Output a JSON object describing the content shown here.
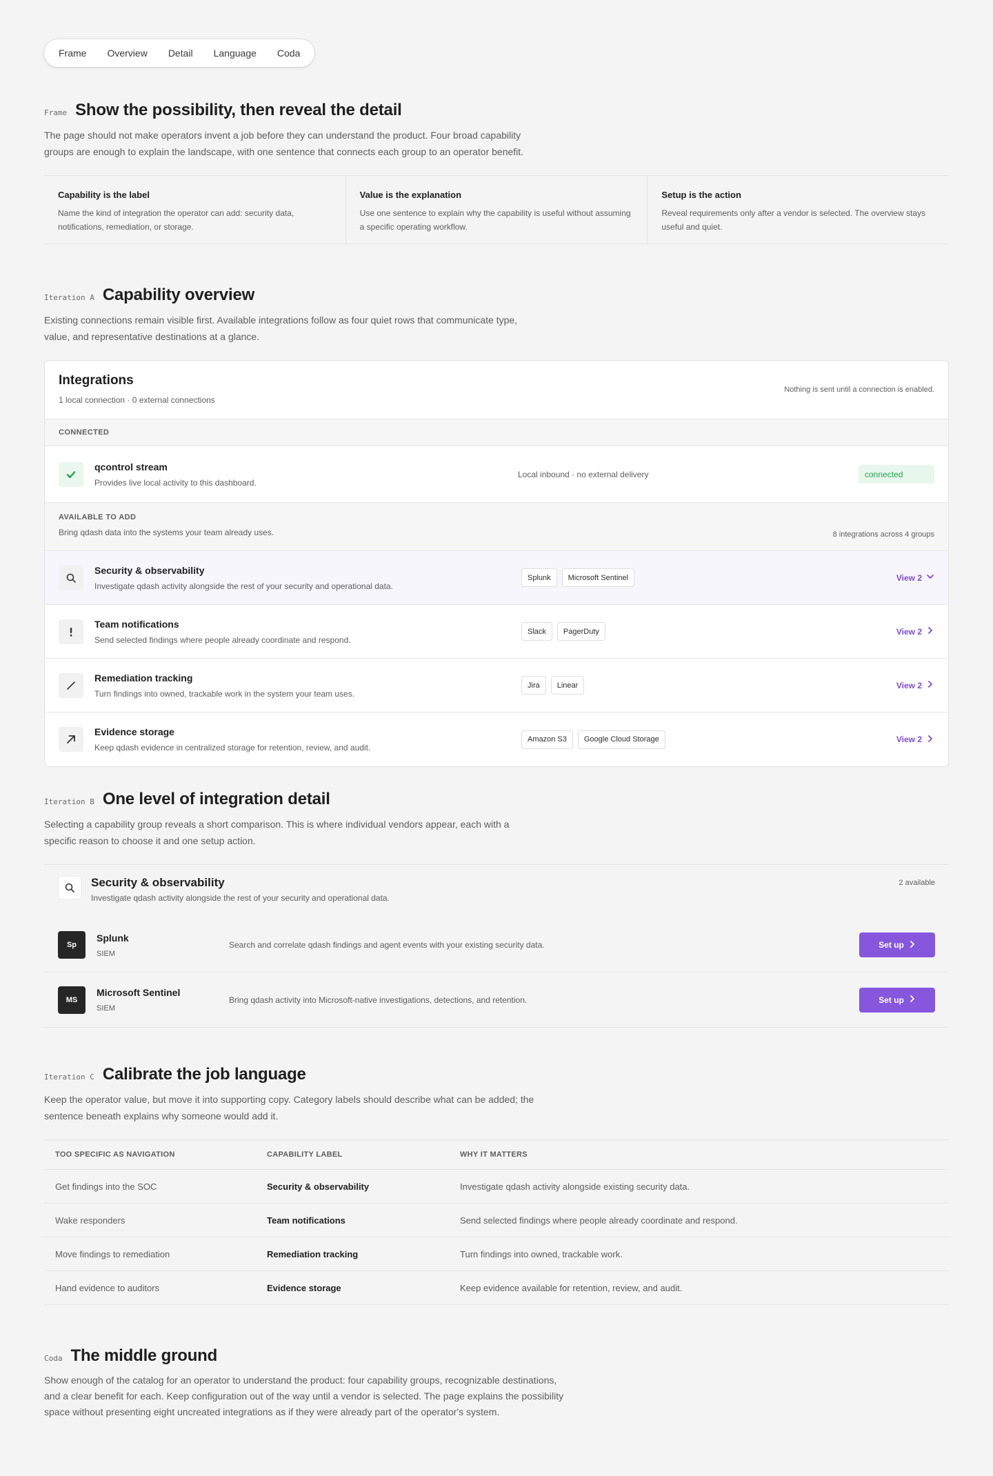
{
  "nav": [
    "Frame",
    "Overview",
    "Detail",
    "Language",
    "Coda"
  ],
  "frame": {
    "tag": "Frame",
    "title": "Show the possibility, then reveal the detail",
    "desc": "The page should not make operators invent a job before they can understand the product. Four broad capability groups are enough to explain the landscape, with one sentence that connects each group to an operator benefit.",
    "cards": [
      {
        "title": "Capability is the label",
        "desc": "Name the kind of integration the operator can add: security data, notifications, remediation, or storage."
      },
      {
        "title": "Value is the explanation",
        "desc": "Use one sentence to explain why the capability is useful without assuming a specific operating workflow."
      },
      {
        "title": "Setup is the action",
        "desc": "Reveal requirements only after a vendor is selected. The overview stays useful and quiet."
      }
    ]
  },
  "iterA": {
    "tag": "Iteration A",
    "title": "Capability overview",
    "desc": "Existing connections remain visible first. Available integrations follow as four quiet rows that communicate type, value, and representative destinations at a glance.",
    "panel": {
      "title": "Integrations",
      "sub": "1 local connection · 0 external connections",
      "note": "Nothing is sent until a connection is enabled.",
      "connected_label": "CONNECTED",
      "connected": {
        "name": "qcontrol stream",
        "desc": "Provides live local activity to this dashboard.",
        "meta": "Local inbound · no external delivery",
        "status": "connected",
        "status_color": "#24a24d"
      },
      "avail_label": "AVAILABLE TO ADD",
      "avail_desc": "Bring qdash data into the systems your team already uses.",
      "avail_count": "8 integrations across 4 groups",
      "groups": [
        {
          "icon": "search-icon",
          "name": "Security & observability",
          "desc": "Investigate qdash activity alongside the rest of your security and operational data.",
          "chips": [
            "Splunk",
            "Microsoft Sentinel"
          ],
          "view": "View 2",
          "selected": true
        },
        {
          "icon": "exclamation-icon",
          "name": "Team notifications",
          "desc": "Send selected findings where people already coordinate and respond.",
          "chips": [
            "Slack",
            "PagerDuty"
          ],
          "view": "View 2",
          "selected": false
        },
        {
          "icon": "pencil-icon",
          "name": "Remediation tracking",
          "desc": "Turn findings into owned, trackable work in the system your team uses.",
          "chips": [
            "Jira",
            "Linear"
          ],
          "view": "View 2",
          "selected": false
        },
        {
          "icon": "arrow-up-right-icon",
          "name": "Evidence storage",
          "desc": "Keep qdash evidence in centralized storage for retention, review, and audit.",
          "chips": [
            "Amazon S3",
            "Google Cloud Storage"
          ],
          "view": "View 2",
          "selected": false
        }
      ]
    }
  },
  "iterB": {
    "tag": "Iteration B",
    "title": "One level of integration detail",
    "desc": "Selecting a capability group reveals a short comparison. This is where individual vendors appear, each with a specific reason to choose it and one setup action.",
    "group": {
      "name": "Security & observability",
      "desc": "Investigate qdash activity alongside the rest of your security and operational data.",
      "avail": "2 available"
    },
    "vendors": [
      {
        "logo": "Sp",
        "name": "Splunk",
        "kind": "SIEM",
        "desc": "Search and correlate qdash findings and agent events with your existing security data.",
        "action": "Set up"
      },
      {
        "logo": "MS",
        "name": "Microsoft Sentinel",
        "kind": "SIEM",
        "desc": "Bring qdash activity into Microsoft-native investigations, detections, and retention.",
        "action": "Set up"
      }
    ]
  },
  "iterC": {
    "tag": "Iteration C",
    "title": "Calibrate the job language",
    "desc": "Keep the operator value, but move it into supporting copy. Category labels should describe what can be added; the sentence beneath explains why someone would add it.",
    "headers": [
      "TOO SPECIFIC AS NAVIGATION",
      "CAPABILITY LABEL",
      "WHY IT MATTERS"
    ],
    "rows": [
      [
        "Get findings into the SOC",
        "Security & observability",
        "Investigate qdash activity alongside existing security data."
      ],
      [
        "Wake responders",
        "Team notifications",
        "Send selected findings where people already coordinate and respond."
      ],
      [
        "Move findings to remediation",
        "Remediation tracking",
        "Turn findings into owned, trackable work."
      ],
      [
        "Hand evidence to auditors",
        "Evidence storage",
        "Keep evidence available for retention, review, and audit."
      ]
    ]
  },
  "coda": {
    "tag": "Coda",
    "title": "The middle ground",
    "desc": "Show enough of the catalog for an operator to understand the product: four capability groups, recognizable destinations, and a clear benefit for each. Keep configuration out of the way until a vendor is selected. The page explains the possibility space without presenting eight uncreated integrations as if they were already part of the operator's system."
  },
  "colors": {
    "accent": "#8656dd",
    "accent_text": "#7d4bd8",
    "success": "#24a24d"
  }
}
